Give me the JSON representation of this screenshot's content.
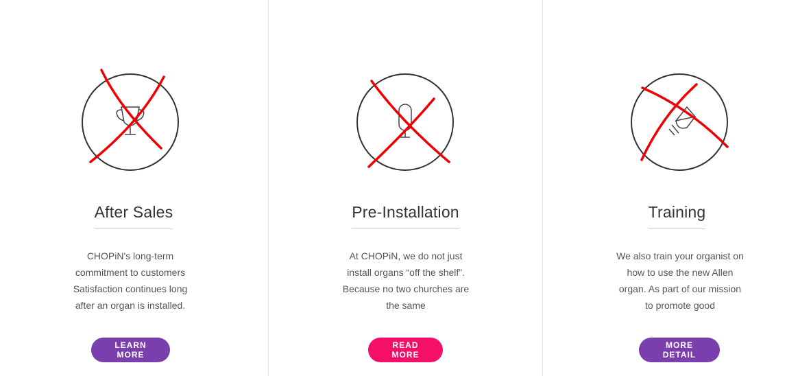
{
  "colors": {
    "purple": "#7b3fad",
    "pink": "#f40f68",
    "cross_red": "#ee0000",
    "icon_stroke": "#333333"
  },
  "services": [
    {
      "icon": "trophy-icon",
      "title": "After Sales",
      "desc_lines": [
        "CHOPiN's long-term",
        "commitment to customers",
        "Satisfaction continues long",
        "after an organ is installed."
      ],
      "button": "LEARN MORE",
      "button_color": "#7b3fad"
    },
    {
      "icon": "microphone-icon",
      "title": "Pre-Installation",
      "desc_lines": [
        "At CHOPiN, we do not just",
        "install organs “off the shelf”.",
        "Because no two churches are",
        "the same"
      ],
      "button": "READ MORE",
      "button_color": "#f40f68"
    },
    {
      "icon": "megaphone-icon",
      "title": "Training",
      "desc_lines": [
        "We also train your organist on",
        "how to use the new Allen",
        "organ. As part of our mission",
        "to promote good"
      ],
      "button": "MORE DETAIL",
      "button_color": "#7b3fad"
    }
  ]
}
